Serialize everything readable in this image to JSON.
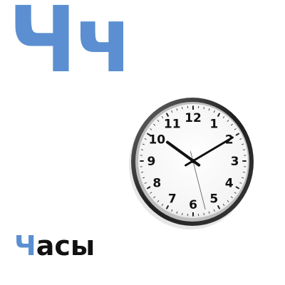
{
  "letter_pair": {
    "upper": "Ч",
    "lower": "ч",
    "color": "#5b8fd1"
  },
  "word": {
    "first_letter": "Ч",
    "rest": "асы",
    "first_color": "#5b8fd1",
    "rest_color": "#111111"
  },
  "clock": {
    "numbers": [
      "12",
      "1",
      "2",
      "3",
      "4",
      "5",
      "6",
      "7",
      "8",
      "9",
      "10",
      "11"
    ],
    "time": "10:10",
    "icon": "wall-clock-icon"
  }
}
